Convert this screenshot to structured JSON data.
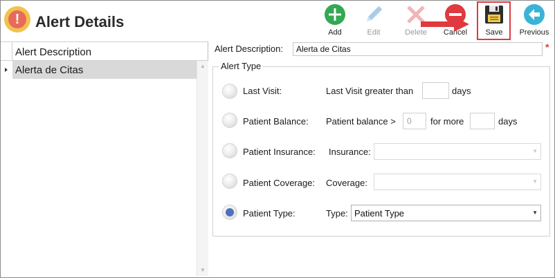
{
  "header": {
    "title": "Alert Details",
    "toolbar": {
      "add": "Add",
      "edit": "Edit",
      "delete": "Delete",
      "cancel": "Cancel",
      "save": "Save",
      "previous": "Previous"
    }
  },
  "grid": {
    "column_header": "Alert Description",
    "rows": [
      "Alerta de Citas"
    ]
  },
  "form": {
    "description_label": "Alert Description:",
    "description_value": "Alerta de Citas",
    "required_mark": "*",
    "group_label": "Alert Type",
    "options": {
      "last_visit": {
        "label": "Last Visit:",
        "text": "Last Visit greater than",
        "suffix": "days"
      },
      "patient_balance": {
        "label": "Patient Balance:",
        "text": "Patient balance >",
        "amount": "0",
        "middle": "for more",
        "suffix": "days"
      },
      "patient_insurance": {
        "label": "Patient Insurance:",
        "text": "Insurance:"
      },
      "patient_coverage": {
        "label": "Patient Coverage:",
        "text": "Coverage:"
      },
      "patient_type": {
        "label": "Patient Type:",
        "text": "Type:",
        "selected": "Patient Type"
      }
    }
  },
  "colors": {
    "add": "#34a853",
    "cancel": "#e0393e",
    "previous": "#3ab3d6",
    "highlight": "#e0393e",
    "radio_selected": "#4d72b8"
  },
  "icons": [
    "alert-icon",
    "add-icon",
    "edit-icon",
    "delete-icon",
    "cancel-icon",
    "save-icon",
    "previous-icon",
    "arrow-icon"
  ]
}
